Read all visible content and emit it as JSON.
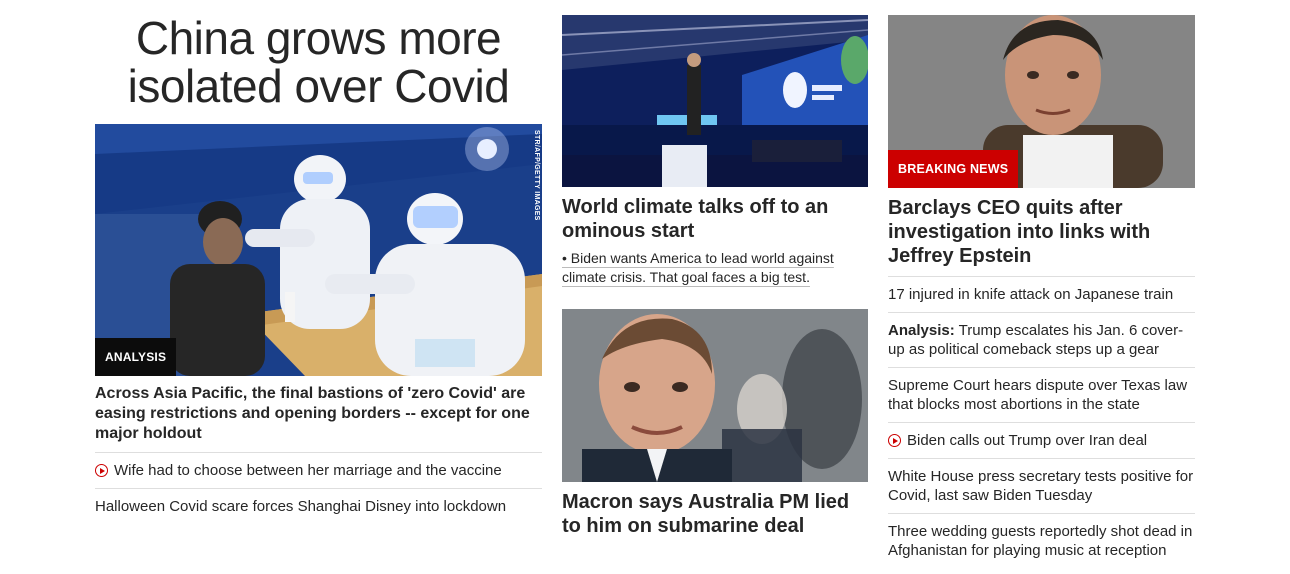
{
  "lead": {
    "headline": "China grows more isolated over Covid",
    "image_credit": "STR/AFP/GETTY IMAGES",
    "tag": "ANALYSIS",
    "caption": "Across Asia Pacific, the final bastions of 'zero Covid' are easing restrictions and opening borders -- except for one major holdout",
    "related": [
      {
        "text": "Wife had to choose between her marriage and the vaccine",
        "video": true
      },
      {
        "text": "Halloween Covid scare forces Shanghai Disney into lockdown",
        "video": false
      }
    ]
  },
  "middle": {
    "story1": {
      "title": "World climate talks off to an ominous start",
      "bullet": "• Biden wants America to lead world against climate crisis. That goal faces a big test."
    },
    "story2": {
      "title": "Macron says Australia PM lied to him on submarine deal"
    }
  },
  "right": {
    "tag": "BREAKING NEWS",
    "title": "Barclays CEO quits after investigation into links with Jeffrey Epstein",
    "items": [
      {
        "label": "",
        "text": "17 injured in knife attack on Japanese train",
        "video": false
      },
      {
        "label": "Analysis:",
        "text": " Trump escalates his Jan. 6 cover-up as political comeback steps up a gear",
        "video": false
      },
      {
        "label": "",
        "text": "Supreme Court hears dispute over Texas law that blocks most abortions in the state",
        "video": false
      },
      {
        "label": "",
        "text": "Biden calls out Trump over Iran deal",
        "video": true
      },
      {
        "label": "",
        "text": "White House press secretary tests positive for Covid, last saw Biden Tuesday",
        "video": false
      },
      {
        "label": "",
        "text": "Three wedding guests reportedly shot dead in Afghanistan for playing music at reception",
        "video": false
      }
    ]
  },
  "colors": {
    "accent": "#cc0000",
    "text": "#262626",
    "divider": "#dedede"
  }
}
